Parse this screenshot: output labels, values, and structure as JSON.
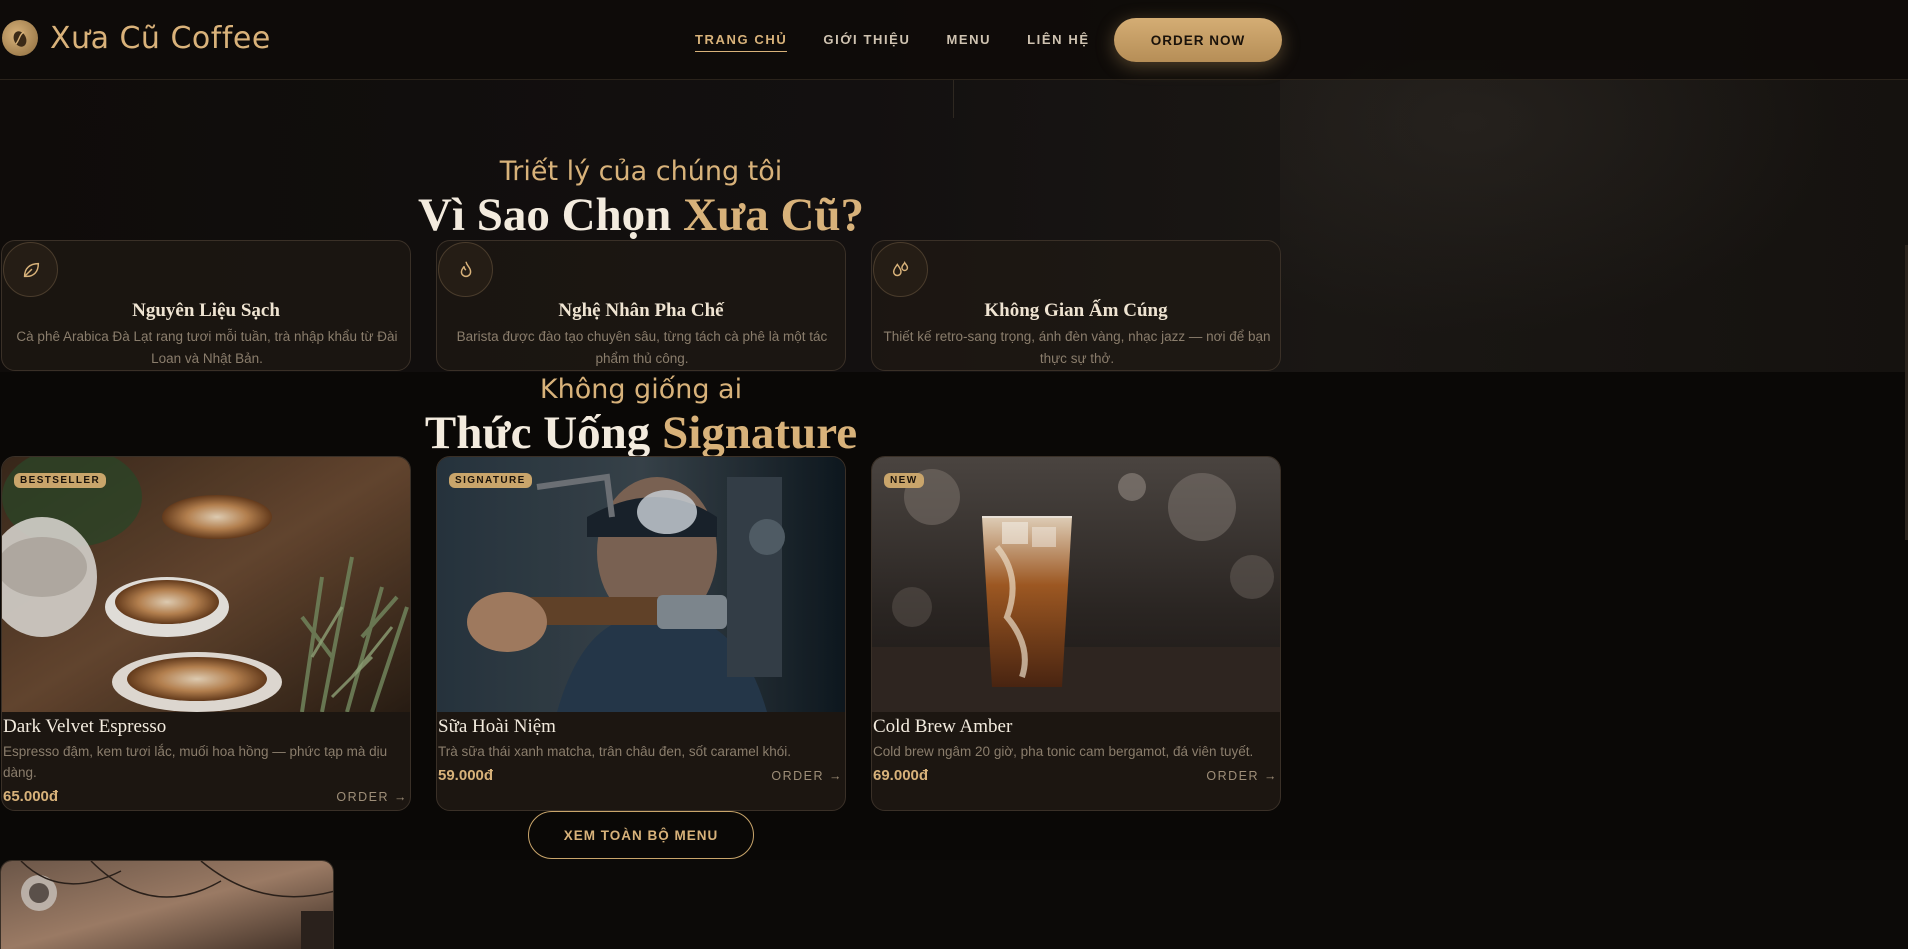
{
  "brand": {
    "name": "Xưa Cũ Coffee"
  },
  "nav": {
    "links": [
      {
        "label": "TRANG CHỦ",
        "active": true
      },
      {
        "label": "GIỚI THIỆU",
        "active": false
      },
      {
        "label": "MENU",
        "active": false
      },
      {
        "label": "LIÊN HỆ",
        "active": false
      }
    ],
    "cta": "ORDER NOW"
  },
  "why": {
    "eyebrow": "Triết lý của chúng tôi",
    "title_main": "Vì Sao Chọn ",
    "title_accent": "Xưa Cũ?",
    "features": [
      {
        "icon": "leaf-icon",
        "title": "Nguyên Liệu Sạch",
        "desc": "Cà phê Arabica Đà Lạt rang tươi mỗi tuần, trà nhập khẩu từ Đài Loan và Nhật Bản."
      },
      {
        "icon": "flame-icon",
        "title": "Nghệ Nhân Pha Chế",
        "desc": "Barista được đào tạo chuyên sâu, từng tách cà phê là một tác phẩm thủ công."
      },
      {
        "icon": "drops-icon",
        "title": "Không Gian Ấm Cúng",
        "desc": "Thiết kế retro-sang trọng, ánh đèn vàng, nhạc jazz — nơi để bạn thực sự thở."
      }
    ]
  },
  "signature": {
    "eyebrow": "Không giống ai",
    "title_main": "Thức Uống ",
    "title_accent": "Signature",
    "products": [
      {
        "badge": "BESTSELLER",
        "name": "Dark Velvet Espresso",
        "desc": "Espresso đậm, kem tươi lắc, muối hoa hồng — phức tạp mà dịu dàng.",
        "price": "65.000đ",
        "order": "ORDER →"
      },
      {
        "badge": "SIGNATURE",
        "name": "Sữa Hoài Niệm",
        "desc": "Trà sữa thái xanh matcha, trân châu đen, sốt caramel khói.",
        "price": "59.000đ",
        "order": "ORDER →"
      },
      {
        "badge": "NEW",
        "name": "Cold Brew Amber",
        "desc": "Cold brew ngâm 20 giờ, pha tonic cam bergamot, đá viên tuyết.",
        "price": "69.000đ",
        "order": "ORDER →"
      }
    ],
    "menu_button": "XEM TOÀN BỘ MENU"
  },
  "colors": {
    "accent": "#d8b27a",
    "background": "#0b0806",
    "card": "#1c1611"
  }
}
